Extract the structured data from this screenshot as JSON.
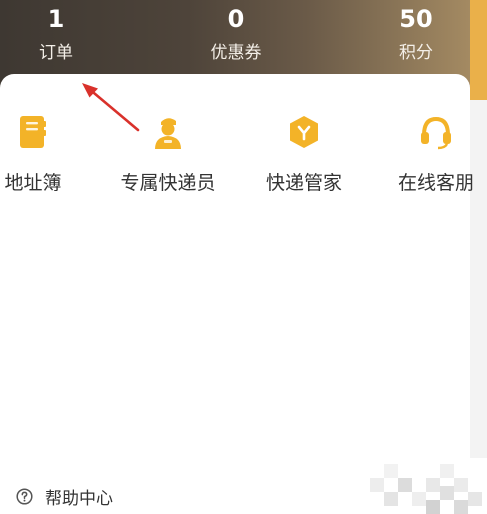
{
  "stats": {
    "orders": {
      "value": "1",
      "label": "订单"
    },
    "coupons": {
      "value": "0",
      "label": "优惠券"
    },
    "points": {
      "value": "50",
      "label": "积分"
    }
  },
  "services": [
    {
      "label": "地址簿",
      "icon": "address-book-icon"
    },
    {
      "label": "专属快递员",
      "icon": "courier-icon"
    },
    {
      "label": "快递管家",
      "icon": "box-icon"
    },
    {
      "label": "在线客朋",
      "icon": "headset-icon"
    }
  ],
  "help": {
    "label": "帮助中心",
    "icon": "question-circle-icon"
  },
  "colors": {
    "header_dark": "#3e3832",
    "header_gold": "#a48a62",
    "accent_yellow": "#f3b328",
    "strip_yellow": "#eab04a",
    "annotation_red": "#d9312b",
    "card": "#ffffff"
  }
}
